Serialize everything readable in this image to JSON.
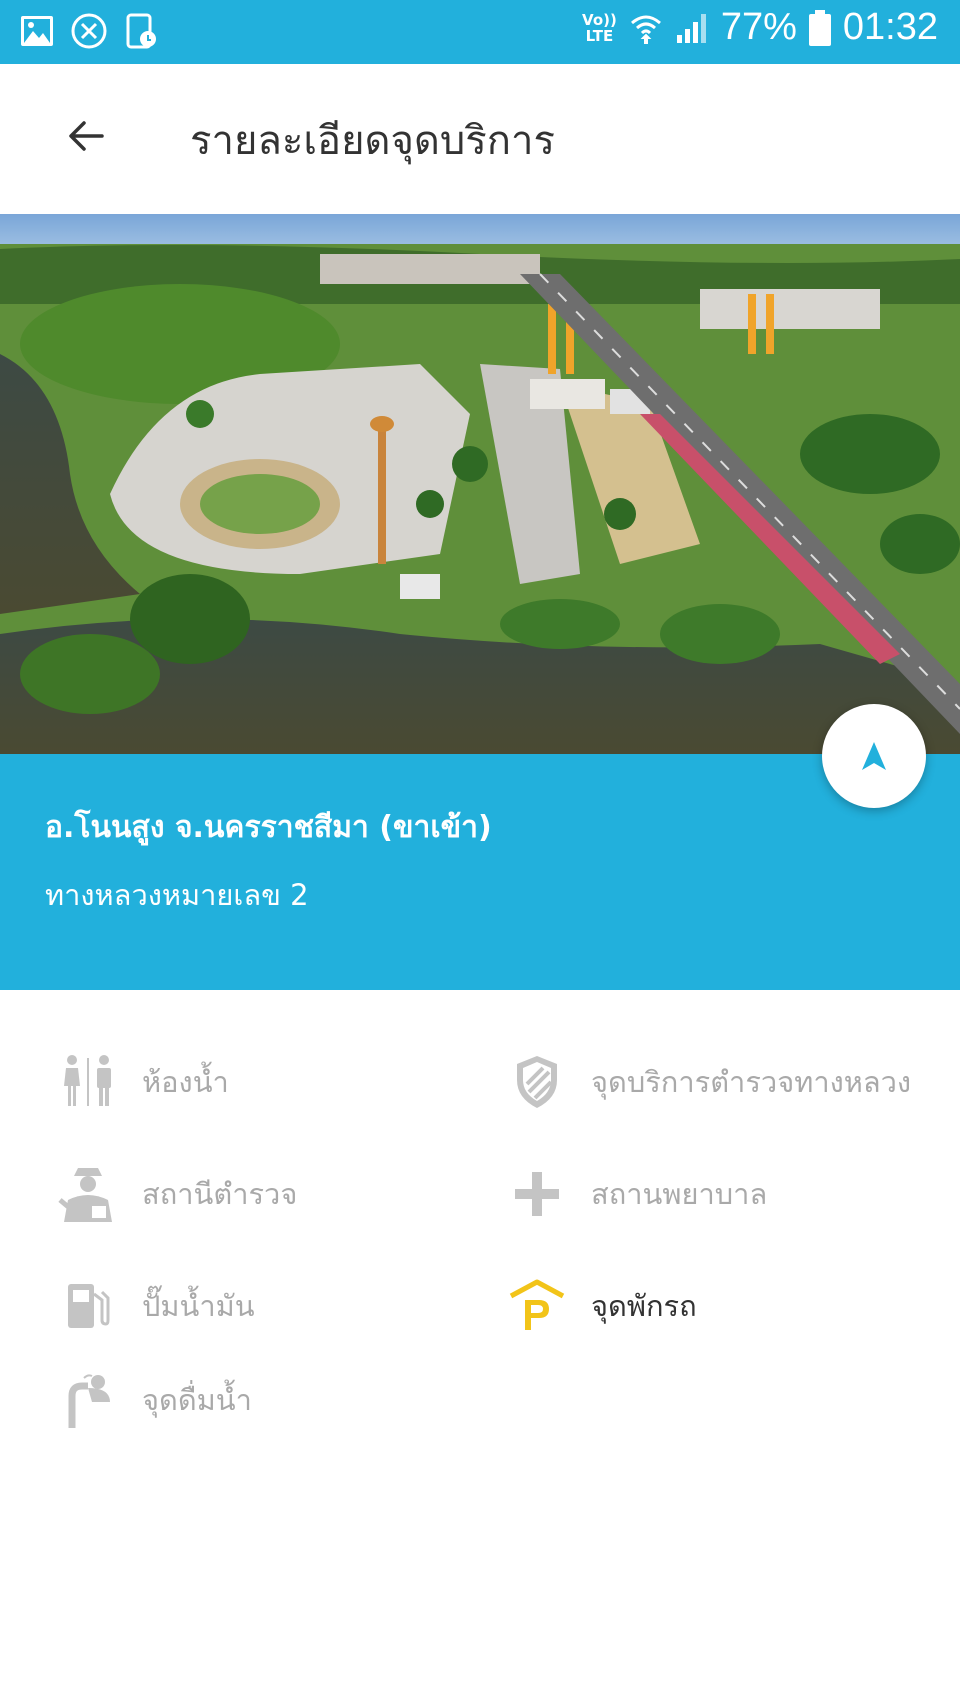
{
  "status_bar": {
    "network": "VoLTE",
    "battery_percent": "77%",
    "time": "01:32"
  },
  "app_bar": {
    "title": "รายละเอียดจุดบริการ"
  },
  "place": {
    "name": "อ.โนนสูง จ.นครราชสีมา (ขาเข้า)",
    "road": "ทางหลวงหมายเลข 2"
  },
  "amenities": [
    {
      "label": "ห้องน้ำ",
      "icon": "restroom-icon",
      "available": false
    },
    {
      "label": "จุดบริการตำรวจทางหลวง",
      "icon": "shield-icon",
      "available": false
    },
    {
      "label": "สถานีตำรวจ",
      "icon": "police-officer-icon",
      "available": false
    },
    {
      "label": "สถานพยาบาล",
      "icon": "medical-cross-icon",
      "available": false
    },
    {
      "label": "ปั๊มน้ำมัน",
      "icon": "fuel-pump-icon",
      "available": false
    },
    {
      "label": "จุดพักรถ",
      "icon": "parking-icon",
      "available": true
    },
    {
      "label": "จุดดื่มน้ำ",
      "icon": "drinking-fountain-icon",
      "available": false
    }
  ],
  "colors": {
    "primary": "#22b0dc",
    "available_icon": "#f2c419",
    "unavailable": "#a9a9a9"
  }
}
